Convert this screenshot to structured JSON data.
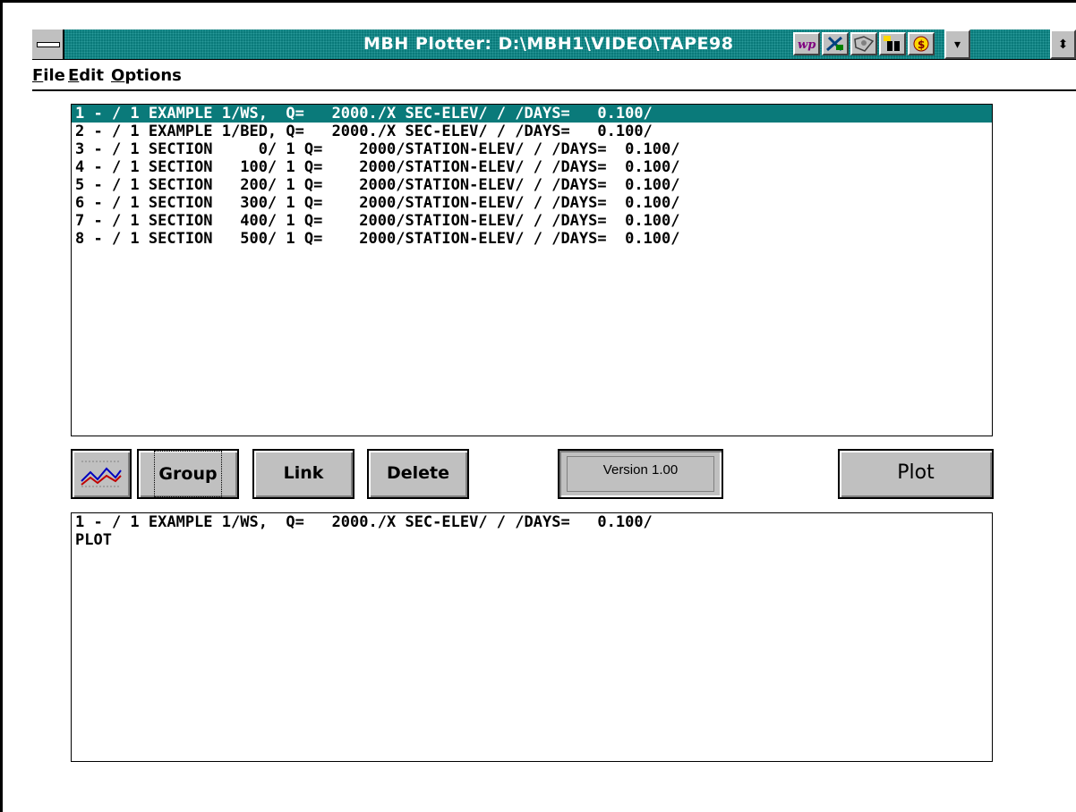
{
  "window": {
    "title": "MBH Plotter: D:\\MBH1\\VIDEO\\TAPE98",
    "toolbar_icons": [
      "wp-icon",
      "tools-icon",
      "map-icon",
      "binoculars-icon",
      "dollar-icon"
    ],
    "controls": {
      "minimize": "▾",
      "restore": "⬍"
    }
  },
  "menu": {
    "items": [
      {
        "label": "File",
        "underline": "F",
        "rest": "ile"
      },
      {
        "label": "Edit",
        "underline": "E",
        "rest": "dit"
      },
      {
        "label": "Options",
        "underline": "O",
        "rest": "ptions"
      }
    ]
  },
  "profile_list": {
    "rows": [
      "1 - / 1 EXAMPLE 1/WS,  Q=   2000./X SEC-ELEV/ / /DAYS=   0.100/",
      "2 - / 1 EXAMPLE 1/BED, Q=   2000./X SEC-ELEV/ / /DAYS=   0.100/",
      "3 - / 1 SECTION     0/ 1 Q=    2000/STATION-ELEV/ / /DAYS=  0.100/",
      "4 - / 1 SECTION   100/ 1 Q=    2000/STATION-ELEV/ / /DAYS=  0.100/",
      "5 - / 1 SECTION   200/ 1 Q=    2000/STATION-ELEV/ / /DAYS=  0.100/",
      "6 - / 1 SECTION   300/ 1 Q=    2000/STATION-ELEV/ / /DAYS=  0.100/",
      "7 - / 1 SECTION   400/ 1 Q=    2000/STATION-ELEV/ / /DAYS=  0.100/",
      "8 - / 1 SECTION   500/ 1 Q=    2000/STATION-ELEV/ / /DAYS=  0.100/"
    ],
    "selected_index": 0
  },
  "buttons": {
    "chart_icon": "line-chart-icon",
    "group": "Group",
    "link": "Link",
    "delete": "Delete",
    "version": "Version 1.00",
    "plot": "Plot"
  },
  "output_list": {
    "rows": [
      "1 - / 1 EXAMPLE 1/WS,  Q=   2000./X SEC-ELEV/ / /DAYS=   0.100/",
      "PLOT"
    ]
  },
  "colors": {
    "titlebar": "#0a7a7a",
    "selection": "#0a7a7a",
    "button_face": "#c0c0c0"
  }
}
